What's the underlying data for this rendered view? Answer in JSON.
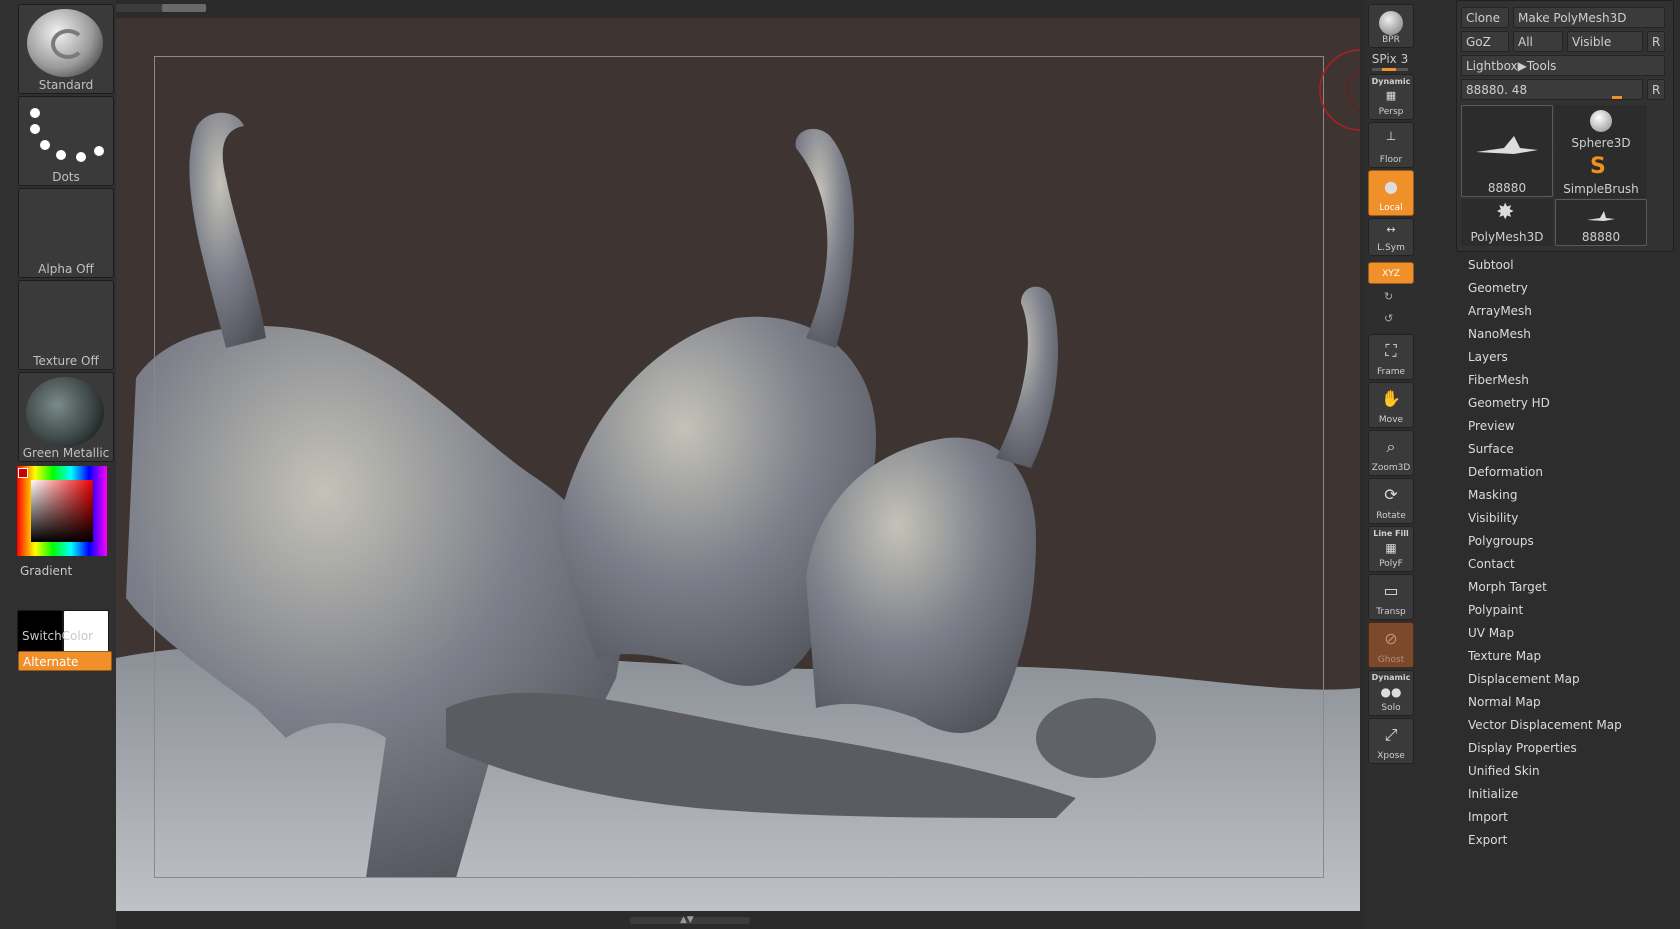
{
  "left_shelf": {
    "brush": "Standard",
    "stroke": "Dots",
    "alpha": "Alpha Off",
    "texture": "Texture Off",
    "material": "Green Metallic",
    "gradient_label": "Gradient",
    "switch_color_label": "SwitchColor",
    "alternate_label": "Alternate",
    "colors": {
      "primary": "#000000",
      "secondary": "#ffffff",
      "accent": "#f0902a"
    }
  },
  "right_shelf": {
    "bpr": "BPR",
    "spix": "SPix 3",
    "dynamic_label": "Dynamic",
    "persp": "Persp",
    "floor": "Floor",
    "local": "Local",
    "lsym": "L.Sym",
    "xyz": "XYZ",
    "frame": "Frame",
    "move": "Move",
    "zoom3d": "Zoom3D",
    "rotate": "Rotate",
    "line_fill": "Line Fill",
    "polyf": "PolyF",
    "transp": "Transp",
    "ghost": "Ghost",
    "dynamic2": "Dynamic",
    "solo": "Solo",
    "xpose": "Xpose"
  },
  "tool_panel": {
    "clone": "Clone",
    "make_polymesh": "Make PolyMesh3D",
    "goz": "GoZ",
    "all": "All",
    "visible": "Visible",
    "r": "R",
    "lightbox": "Lightbox▶Tools",
    "slider_label": "88880. 48",
    "r2": "R",
    "thumbs": {
      "current": "88880",
      "sphere3d": "Sphere3D",
      "simplebrush": "SimpleBrush",
      "polymesh3d": "PolyMesh3D",
      "small": "88880"
    },
    "menu": [
      "Subtool",
      "Geometry",
      "ArrayMesh",
      "NanoMesh",
      "Layers",
      "FiberMesh",
      "Geometry HD",
      "Preview",
      "Surface",
      "Deformation",
      "Masking",
      "Visibility",
      "Polygroups",
      "Contact",
      "Morph Target",
      "Polypaint",
      "UV Map",
      "Texture Map",
      "Displacement Map",
      "Normal Map",
      "Vector Displacement Map",
      "Display Properties",
      "Unified Skin",
      "Initialize",
      "Import",
      "Export"
    ]
  }
}
